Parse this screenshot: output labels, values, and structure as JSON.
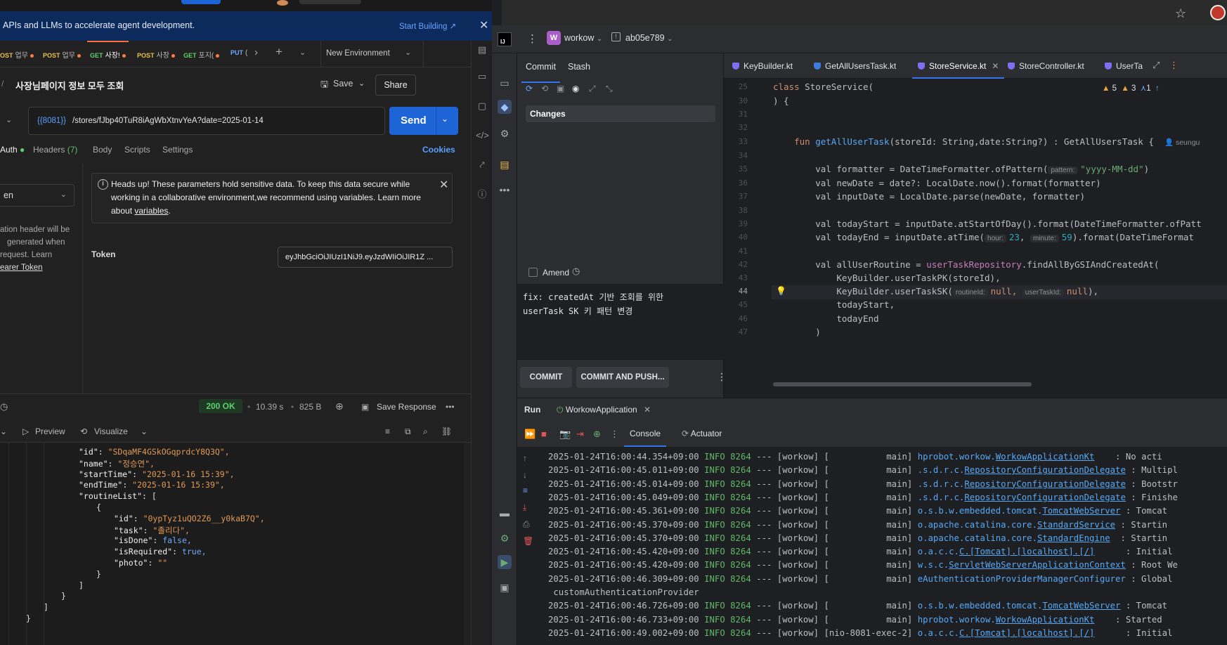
{
  "postman": {
    "banner": {
      "text": "APIs and LLMs to accelerate agent development.",
      "link": "Start Building ↗"
    },
    "tabs": [
      {
        "method": "OST",
        "label": "업무",
        "dot": true
      },
      {
        "method": "POST",
        "label": "업무",
        "dot": true
      },
      {
        "method": "GET",
        "label": "사장!",
        "dot": true,
        "active": true
      },
      {
        "method": "POST",
        "label": "사장",
        "dot": true
      },
      {
        "method": "GET",
        "label": "포지(",
        "dot": true
      },
      {
        "method": "PUT",
        "label": "(",
        "dot": false
      }
    ],
    "environment": "New Environment",
    "request_title": "사장님페이지 정보 모두 조회",
    "save_label": "Save",
    "share_label": "Share",
    "url_var": "{{8081}}",
    "url_path": "/stores/fJbp40TuR8iAgWbXtnvYeA?date=2025-01-14",
    "send_label": "Send",
    "subtabs": {
      "auth": "Auth",
      "headers": "Headers",
      "headers_count": "(7)",
      "body": "Body",
      "scripts": "Scripts",
      "settings": "Settings"
    },
    "cookies": "Cookies",
    "auth_type": "en",
    "auth_help": {
      "line1": "ation header will be",
      "line2": "generated when",
      "line3": "request. Learn",
      "link": "earer Token"
    },
    "alert": {
      "text": "Heads up! These parameters hold sensitive data. To keep this data secure while working in a collaborative environment,we recommend using variables. Learn more about",
      "link": "variables",
      "tail": "."
    },
    "token_label": "Token",
    "token_value": "eyJhbGciOiJIUzI1NiJ9.eyJzdWIiOiJIR1Z ...",
    "response": {
      "status": "200 OK",
      "time": "10.39 s",
      "size": "825 B",
      "save_response": "Save Response",
      "preview": "Preview",
      "visualize": "Visualize"
    },
    "json_lines": [
      {
        "indent": 0,
        "key": "\"id\"",
        "val": "\"SDqaMF4GSkOGqprdcY8Q3Q\","
      },
      {
        "indent": 0,
        "key": "\"name\"",
        "val": "\"정승연\","
      },
      {
        "indent": 0,
        "key": "\"startTime\"",
        "val": "\"2025-01-16 15:39\","
      },
      {
        "indent": 0,
        "key": "\"endTime\"",
        "val": "\"2025-01-16 15:39\","
      },
      {
        "indent": 0,
        "key": "\"routineList\"",
        "val": "["
      },
      {
        "indent": 1,
        "raw": "{"
      },
      {
        "indent": 2,
        "key": "\"id\"",
        "val": "\"0ypTyz1uQO2Z6__y0kaB7Q\","
      },
      {
        "indent": 2,
        "key": "\"task\"",
        "val": "\"졸리다\","
      },
      {
        "indent": 2,
        "key": "\"isDone\"",
        "bool": "false,"
      },
      {
        "indent": 2,
        "key": "\"isRequired\"",
        "bool": "true,"
      },
      {
        "indent": 2,
        "key": "\"photo\"",
        "val": "\"\""
      },
      {
        "indent": 1,
        "raw": "}"
      },
      {
        "indent": 0,
        "raw": "]"
      },
      {
        "indent": -1,
        "raw": "}"
      },
      {
        "indent": -2,
        "raw": "]"
      },
      {
        "indent": -3,
        "raw": "}"
      }
    ]
  },
  "ide": {
    "project_badge": "W",
    "project": "workow",
    "branch": "ab05e789",
    "commit_tabs": {
      "commit": "Commit",
      "stash": "Stash"
    },
    "changes": "Changes",
    "amend": "Amend",
    "commit_message": "fix: createdAt 기반 조회를 위한 \nuserTask SK 키 패턴 변경",
    "commit_btn": "COMMIT",
    "commit_push_btn": "COMMIT AND PUSH...",
    "editor_tabs": [
      {
        "label": "KeyBuilder.kt"
      },
      {
        "label": "GetAllUsersTask.kt"
      },
      {
        "label": "StoreService.kt",
        "active": true
      },
      {
        "label": "StoreController.kt"
      },
      {
        "label": "UserTa"
      }
    ],
    "inspections": {
      "warn1": "5",
      "warn2": "3",
      "weak": "1"
    },
    "author": "seungu",
    "line_numbers": [
      "25",
      "30",
      "31",
      "32",
      "33",
      "34",
      "35",
      "36",
      "37",
      "38",
      "39",
      "40",
      "41",
      "42",
      "43",
      "44",
      "45",
      "46",
      "47"
    ],
    "code": {
      "l25_kw": "class",
      "l25_rest": " StoreService(",
      "l30": ") {",
      "l33_kw": "fun",
      "l33_fn": "getAllUserTask",
      "l33_rest": "(storeId: String,date:String?) : GetAllUsersTask {",
      "l35_a": "val formatter = DateTimeFormatter.ofPattern(",
      "l35_hint": "pattern:",
      "l35_str": "\"yyyy-MM-dd\"",
      "l35_b": ")",
      "l36": "val newDate = date?: LocalDate.now().format(formatter)",
      "l37": "val inputDate = LocalDate.parse(newDate, formatter)",
      "l39": "val todayStart = inputDate.atStartOfDay().format(DateTimeFormatter.ofPatt",
      "l40_a": "val todayEnd = inputDate.atTime(",
      "l40_hint1": "hour:",
      "l40_n1": "23",
      "l40_hint2": "minute:",
      "l40_n2": "59",
      "l40_b": ").format(DateTimeFormat",
      "l42_a": "val allUserRoutine = ",
      "l42_prop": "userTaskRepository",
      "l42_b": ".findAllByGSIAndCreatedAt(",
      "l43": "KeyBuilder.userTaskPK(storeId),",
      "l44_a": "KeyBuilder.userTaskSK(",
      "l44_hint1": "routineId:",
      "l44_null1": "null,",
      "l44_hint2": "userTaskId:",
      "l44_null2": "null",
      "l44_b": "),",
      "l45": "todayStart,",
      "l46": "todayEnd",
      "l47": ")"
    },
    "run": {
      "label": "Run",
      "app": "WorkowApplication",
      "console": "Console",
      "actuator": "Actuator"
    },
    "logs": [
      {
        "ts": "2025-01-24T16:00:44.354+09:00",
        "lvl": "INFO",
        "pid": "8264",
        "sep": "---",
        "app": "[workow]",
        "thread": "[           main]",
        "pkg": "hprobot.workow.",
        "cls": "WorkowApplicationKt",
        "msg": "    : No acti"
      },
      {
        "ts": "2025-01-24T16:00:45.011+09:00",
        "lvl": "INFO",
        "pid": "8264",
        "sep": "---",
        "app": "[workow]",
        "thread": "[           main]",
        "pkg": ".s.d.r.c.",
        "cls": "RepositoryConfigurationDelegate",
        "msg": " : Multipl"
      },
      {
        "ts": "2025-01-24T16:00:45.014+09:00",
        "lvl": "INFO",
        "pid": "8264",
        "sep": "---",
        "app": "[workow]",
        "thread": "[           main]",
        "pkg": ".s.d.r.c.",
        "cls": "RepositoryConfigurationDelegate",
        "msg": " : Bootstr"
      },
      {
        "ts": "2025-01-24T16:00:45.049+09:00",
        "lvl": "INFO",
        "pid": "8264",
        "sep": "---",
        "app": "[workow]",
        "thread": "[           main]",
        "pkg": ".s.d.r.c.",
        "cls": "RepositoryConfigurationDelegate",
        "msg": " : Finishe"
      },
      {
        "ts": "2025-01-24T16:00:45.361+09:00",
        "lvl": "INFO",
        "pid": "8264",
        "sep": "---",
        "app": "[workow]",
        "thread": "[           main]",
        "pkg": "o.s.b.w.embedded.tomcat.",
        "cls": "TomcatWebServer",
        "msg": " : Tomcat "
      },
      {
        "ts": "2025-01-24T16:00:45.370+09:00",
        "lvl": "INFO",
        "pid": "8264",
        "sep": "---",
        "app": "[workow]",
        "thread": "[           main]",
        "pkg": "o.apache.catalina.core.",
        "cls": "StandardService",
        "msg": " : Startin"
      },
      {
        "ts": "2025-01-24T16:00:45.370+09:00",
        "lvl": "INFO",
        "pid": "8264",
        "sep": "---",
        "app": "[workow]",
        "thread": "[           main]",
        "pkg": "o.apache.catalina.core.",
        "cls": "StandardEngine",
        "msg": "  : Startin"
      },
      {
        "ts": "2025-01-24T16:00:45.420+09:00",
        "lvl": "INFO",
        "pid": "8264",
        "sep": "---",
        "app": "[workow]",
        "thread": "[           main]",
        "pkg": "o.a.c.c.",
        "cls": "C.[Tomcat].[localhost].[/]",
        "msg": "      : Initial"
      },
      {
        "ts": "2025-01-24T16:00:45.420+09:00",
        "lvl": "INFO",
        "pid": "8264",
        "sep": "---",
        "app": "[workow]",
        "thread": "[           main]",
        "pkg": "w.s.c.",
        "cls": "ServletWebServerApplicationContext",
        "msg": " : Root We"
      },
      {
        "ts": "2025-01-24T16:00:46.309+09:00",
        "lvl": "INFO",
        "pid": "8264",
        "sep": "---",
        "app": "[workow]",
        "thread": "[           main]",
        "pkg": "eAuthenticationProviderManagerConfigurer",
        "cls": "",
        "msg": " : Global "
      },
      {
        "ts": "",
        "lvl": "",
        "pid": "",
        "sep": "",
        "app": "",
        "thread": "",
        "pkg": " customAuthenticationProvider",
        "cls": "",
        "msg": ""
      },
      {
        "ts": "2025-01-24T16:00:46.726+09:00",
        "lvl": "INFO",
        "pid": "8264",
        "sep": "---",
        "app": "[workow]",
        "thread": "[           main]",
        "pkg": "o.s.b.w.embedded.tomcat.",
        "cls": "TomcatWebServer",
        "msg": " : Tomcat "
      },
      {
        "ts": "2025-01-24T16:00:46.733+09:00",
        "lvl": "INFO",
        "pid": "8264",
        "sep": "---",
        "app": "[workow]",
        "thread": "[           main]",
        "pkg": "hprobot.workow.",
        "cls": "WorkowApplicationKt",
        "msg": "    : Started"
      },
      {
        "ts": "2025-01-24T16:00:49.002+09:00",
        "lvl": "INFO",
        "pid": "8264",
        "sep": "---",
        "app": "[workow]",
        "thread": "[nio-8081-exec-2]",
        "pkg": "o.a.c.c.",
        "cls": "C.[Tomcat].[localhost].[/]",
        "msg": "      : Initial"
      }
    ]
  },
  "colors": {
    "postman_accent": "#ff6c37",
    "send_blue": "#1d64d6",
    "ide_accent": "#3574f0",
    "status_ok": "#5cd06a"
  }
}
